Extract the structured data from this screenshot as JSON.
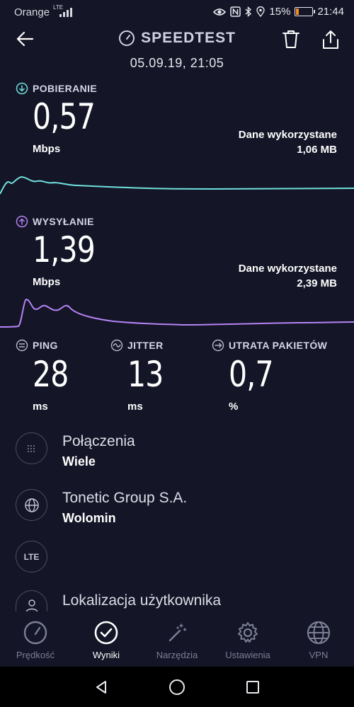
{
  "status_bar": {
    "carrier": "Orange",
    "network_badge": "LTE",
    "battery_percent": "15%",
    "time": "21:44",
    "icons": [
      "eye-icon",
      "nfc-icon",
      "bluetooth-icon",
      "location-icon",
      "battery-icon"
    ]
  },
  "header": {
    "title": "SPEEDTEST",
    "date": "05.09.19, 21:05",
    "icons": [
      "back-arrow-icon",
      "speedometer-icon",
      "trash-icon",
      "share-icon"
    ]
  },
  "download": {
    "label": "POBIERANIE",
    "value": "0,57",
    "unit": "Mbps",
    "data_used_label": "Dane wykorzystane",
    "data_used_value": "1,06 MB",
    "color": "#6fe0dc"
  },
  "upload": {
    "label": "WYSYŁANIE",
    "value": "1,39",
    "unit": "Mbps",
    "data_used_label": "Dane wykorzystane",
    "data_used_value": "2,39 MB",
    "color": "#b583f5"
  },
  "ping": {
    "label": "PING",
    "value": "28",
    "unit": "ms"
  },
  "jitter": {
    "label": "JITTER",
    "value": "13",
    "unit": "ms"
  },
  "packet_loss": {
    "label": "UTRATA PAKIETÓW",
    "value": "0,7",
    "unit": "%"
  },
  "details": [
    {
      "title": "Połączenia",
      "subtitle": "Wiele",
      "icon": "connections-icon"
    },
    {
      "title": "Tonetic Group S.A.",
      "subtitle": "Wolomin",
      "icon": "globe-icon"
    },
    {
      "title": "",
      "subtitle": "",
      "icon": "lte-icon",
      "badge": "LTE"
    },
    {
      "title": "Lokalizacja użytkownika",
      "subtitle": "",
      "icon": "user-icon"
    }
  ],
  "bottom_nav": [
    {
      "label": "Prędkość",
      "icon": "gauge-icon",
      "active": false
    },
    {
      "label": "Wyniki",
      "icon": "checkmark-circle-icon",
      "active": true
    },
    {
      "label": "Narzędzia",
      "icon": "magic-wand-icon",
      "active": false
    },
    {
      "label": "Ustawienia",
      "icon": "gear-icon",
      "active": false
    },
    {
      "label": "VPN",
      "icon": "vpn-globe-icon",
      "active": false
    }
  ],
  "android_nav": [
    "back-triangle-icon",
    "home-circle-icon",
    "recents-square-icon"
  ]
}
